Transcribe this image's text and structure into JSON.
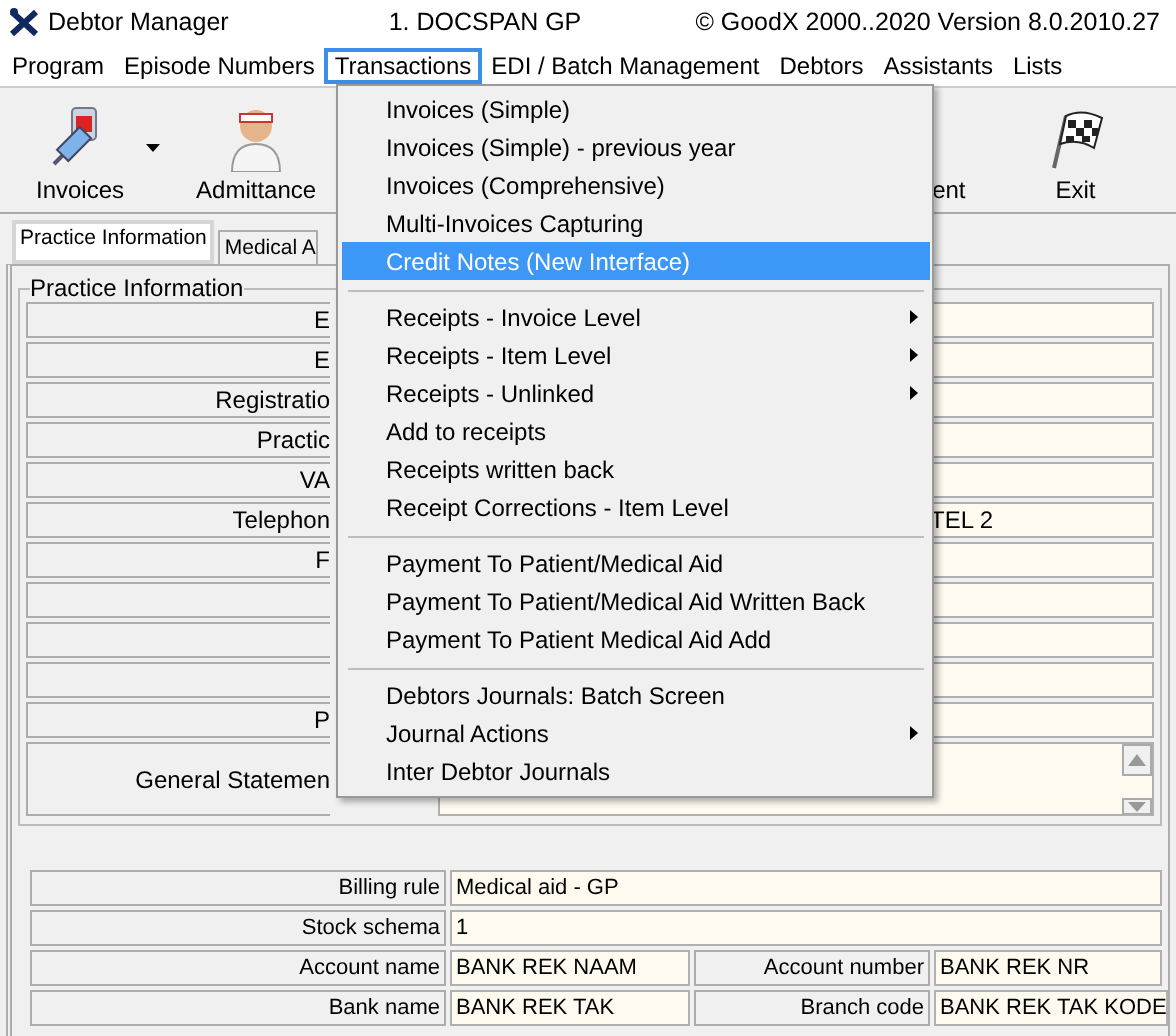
{
  "window": {
    "title": "Debtor Manager",
    "document": "1. DOCSPAN GP",
    "copyright": "© GoodX 2000..2020  Version 8.0.2010.27"
  },
  "menu_bar": [
    {
      "label": "Program",
      "selected": false
    },
    {
      "label": "Episode Numbers",
      "selected": false
    },
    {
      "label": "Transactions",
      "selected": true
    },
    {
      "label": "EDI / Batch Management",
      "selected": false
    },
    {
      "label": "Debtors",
      "selected": false
    },
    {
      "label": "Assistants",
      "selected": false
    },
    {
      "label": "Lists",
      "selected": false
    }
  ],
  "toolbar": [
    {
      "label": "Invoices",
      "kind": "syringe",
      "dropdown": true
    },
    {
      "label": "Admittance",
      "kind": "person",
      "dropdown": false
    },
    {
      "label": "ent",
      "kind": "hidden",
      "dropdown": false
    },
    {
      "label": "Exit",
      "kind": "flag",
      "dropdown": false
    }
  ],
  "tabs": [
    {
      "label": "Practice Information",
      "selected": true
    },
    {
      "label": "Medical A",
      "selected": false
    }
  ],
  "group": {
    "title": "Practice Information",
    "rows": [
      {
        "label": "E"
      },
      {
        "label": "E"
      },
      {
        "label": "Registratio"
      },
      {
        "label": "Practic"
      },
      {
        "label": "VA"
      },
      {
        "label": "Telephon",
        "value": "TEL 2"
      },
      {
        "label": "F"
      },
      {},
      {},
      {},
      {
        "label": "P"
      }
    ],
    "statement": {
      "label": "General Statemen"
    }
  },
  "billing": [
    {
      "label": "Billing rule",
      "value": "Medical aid - GP"
    },
    {
      "label": "Stock schema",
      "value": "1"
    }
  ],
  "bank": [
    {
      "label": "Account name",
      "value": "BANK REK NAAM",
      "label_2": "Account number",
      "value_2": "BANK REK NR"
    },
    {
      "label": "Bank name",
      "value": "BANK REK TAK",
      "label_2": "Branch code",
      "value_2": "BANK REK TAK KODE"
    }
  ],
  "dropdown": {
    "sections": [
      [
        {
          "label": "Invoices (Simple)",
          "selected": false,
          "submenu": false
        },
        {
          "label": "Invoices (Simple) - previous year",
          "selected": false,
          "submenu": false
        },
        {
          "label": "Invoices (Comprehensive)",
          "selected": false,
          "submenu": false
        },
        {
          "label": "Multi-Invoices Capturing",
          "selected": false,
          "submenu": false
        },
        {
          "label": "Credit Notes (New Interface)",
          "selected": true,
          "submenu": false
        }
      ],
      [
        {
          "label": "Receipts - Invoice Level",
          "selected": false,
          "submenu": true
        },
        {
          "label": "Receipts - Item Level",
          "selected": false,
          "submenu": true
        },
        {
          "label": "Receipts - Unlinked",
          "selected": false,
          "submenu": true
        },
        {
          "label": "Add to receipts",
          "selected": false,
          "submenu": false
        },
        {
          "label": "Receipts written back",
          "selected": false,
          "submenu": false
        },
        {
          "label": "Receipt Corrections  - Item Level",
          "selected": false,
          "submenu": false
        }
      ],
      [
        {
          "label": "Payment To Patient/Medical Aid",
          "selected": false,
          "submenu": false
        },
        {
          "label": "Payment To Patient/Medical Aid Written Back",
          "selected": false,
          "submenu": false
        },
        {
          "label": "Payment To Patient Medical Aid  Add",
          "selected": false,
          "submenu": false
        }
      ],
      [
        {
          "label": "Debtors Journals: Batch Screen",
          "selected": false,
          "submenu": false
        },
        {
          "label": "Journal Actions",
          "selected": false,
          "submenu": true
        },
        {
          "label": "Inter Debtor Journals",
          "selected": false,
          "submenu": false
        }
      ]
    ]
  }
}
